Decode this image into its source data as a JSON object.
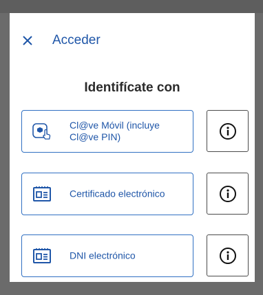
{
  "header": {
    "title": "Acceder",
    "close_icon": "close-icon"
  },
  "main": {
    "heading": "Identifícate con",
    "options": [
      {
        "label": "Cl@ve Móvil (incluye Cl@ve PIN)",
        "icon": "mobile-touch-icon"
      },
      {
        "label": "Certificado electrónico",
        "icon": "certificate-card-icon"
      },
      {
        "label": "DNI electrónico",
        "icon": "id-card-icon"
      }
    ],
    "info_icon": "info-icon"
  },
  "colors": {
    "accent": "#1f56a8",
    "border": "#2f6fc2",
    "overlay": "#6b6b6b"
  }
}
